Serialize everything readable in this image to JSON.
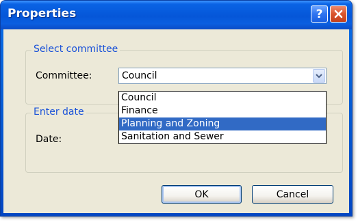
{
  "window": {
    "title": "Properties",
    "help_glyph": "?",
    "close_glyph": "✕"
  },
  "committee_group": {
    "label": "Select committee",
    "field_label": "Committee:",
    "selected_value": "Council",
    "options": [
      "Council",
      "Finance",
      "Planning and Zoning",
      "Sanitation and Sewer"
    ],
    "highlighted_option": "Planning and Zoning"
  },
  "date_group": {
    "label": "Enter date",
    "field_label": "Date:"
  },
  "buttons": {
    "ok_label": "OK",
    "cancel_label": "Cancel"
  },
  "colors": {
    "titlebar": "#0556d8",
    "selection": "#316ac5",
    "group_label": "#1a52d8",
    "dialog_face": "#ece9d8"
  },
  "icons": {
    "help": "help-icon",
    "close": "close-icon",
    "dropdown": "chevron-down-icon"
  }
}
